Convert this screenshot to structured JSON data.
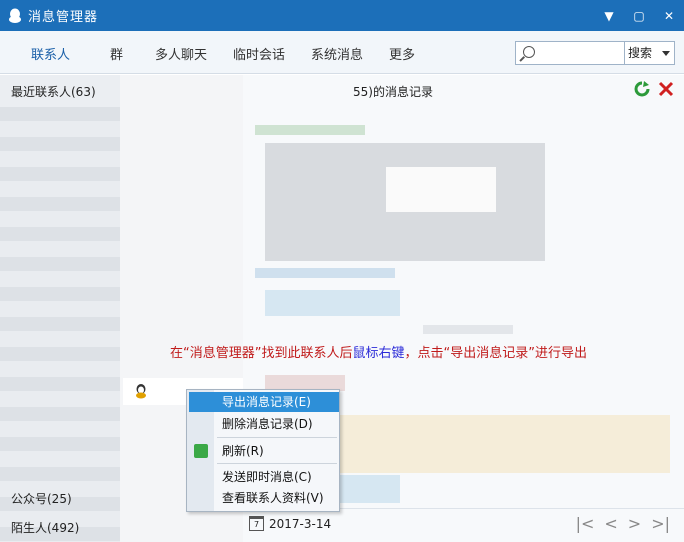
{
  "window": {
    "title": "消息管理器",
    "min": "▼",
    "restore": "▢",
    "close": "✕"
  },
  "tabs": [
    {
      "label": "联系人",
      "active": true
    },
    {
      "label": "群"
    },
    {
      "label": "多人聊天"
    },
    {
      "label": "临时会话"
    },
    {
      "label": "系统消息"
    },
    {
      "label": "更多"
    }
  ],
  "search": {
    "placeholder": "",
    "button": "搜索"
  },
  "left": {
    "recent": "最近联系人(63)",
    "official": "公众号(25)",
    "strangers": "陌生人(492)"
  },
  "right": {
    "title_suffix": "55)的消息记录",
    "annotation": {
      "pre": "在“消息管理器”找到此联系人后",
      "highlight": "鼠标右键",
      "post": "，点击“导出消息记录”进行导出"
    },
    "date": "2017-3-14",
    "cal_icon": "7"
  },
  "context_menu": {
    "items": [
      {
        "label": "导出消息记录(E)"
      },
      {
        "label": "删除消息记录(D)"
      },
      {
        "label": "刷新(R)"
      },
      {
        "label": "发送即时消息(C)"
      },
      {
        "label": "查看联系人资料(V)"
      }
    ]
  },
  "colors": {
    "titlebar": "#1c6fb9",
    "accent": "#2d8fd8",
    "annotation": "#c01b1b",
    "annotation_highlight": "#2b2bd8"
  }
}
